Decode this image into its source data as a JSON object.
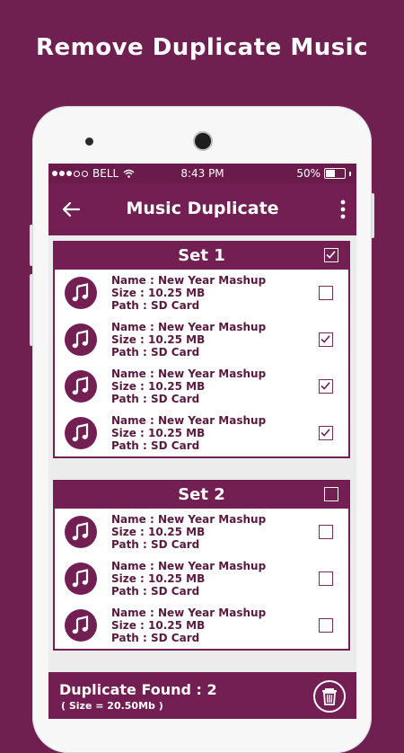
{
  "headline": "Remove Duplicate Music",
  "status_bar": {
    "carrier": "BELL",
    "time": "8:43 PM",
    "battery_percent": "50%",
    "battery_level": 0.5
  },
  "app_bar": {
    "title": "Music Duplicate",
    "back_icon": "arrow-left-icon",
    "menu_icon": "more-vertical-icon"
  },
  "colors": {
    "brand": "#731f53",
    "background": "#6f1f50"
  },
  "sets": [
    {
      "title": "Set 1",
      "checked": true,
      "items": [
        {
          "name": "Name : New Year Mashup",
          "size": "Size : 10.25 MB",
          "path": "Path : SD Card",
          "checked": false
        },
        {
          "name": "Name : New Year Mashup",
          "size": "Size : 10.25 MB",
          "path": "Path : SD Card",
          "checked": true
        },
        {
          "name": "Name : New Year Mashup",
          "size": "Size : 10.25 MB",
          "path": "Path : SD Card",
          "checked": true
        },
        {
          "name": "Name : New Year Mashup",
          "size": "Size : 10.25 MB",
          "path": "Path : SD Card",
          "checked": true
        }
      ]
    },
    {
      "title": "Set 2",
      "checked": false,
      "items": [
        {
          "name": "Name : New Year Mashup",
          "size": "Size : 10.25 MB",
          "path": "Path : SD Card",
          "checked": false
        },
        {
          "name": "Name : New Year Mashup",
          "size": "Size : 10.25 MB",
          "path": "Path : SD Card",
          "checked": false
        },
        {
          "name": "Name : New Year Mashup",
          "size": "Size : 10.25 MB",
          "path": "Path : SD Card",
          "checked": false
        }
      ]
    }
  ],
  "footer": {
    "title": "Duplicate Found : 2",
    "size": "( Size = 20.50Mb )",
    "delete_icon": "trash-icon"
  }
}
